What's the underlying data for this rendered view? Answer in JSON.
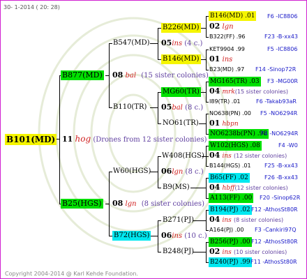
{
  "header": {
    "date": "30-  1-2014 ( 20: 28)"
  },
  "footer": {
    "copyright": "Copyright 2004-2014 @ Karl Kehde Foundation."
  },
  "root": {
    "id": "B101(MD)",
    "count": "11",
    "name": "hog",
    "sisters": "(Drones from 12 sister colonies)"
  },
  "gen1": [
    {
      "id": "B877(MD)",
      "count": "08",
      "name": "bal",
      "sisters": "(15 sister colonies)"
    },
    {
      "id": "B25(HGS)",
      "count": "08",
      "name": "lgn",
      "sisters": "(8 sister colonies)"
    }
  ],
  "gen2": [
    {
      "id": "B547(MD)",
      "count": "05",
      "name": "ins",
      "sisters": "(4 c.)"
    },
    {
      "id": "B110(TR)",
      "count": "05",
      "name": "bal",
      "sisters": "(8 c.)"
    },
    {
      "id": "W60(HGS)",
      "count": "06",
      "name": "lgn",
      "sisters": "(8 c.)"
    },
    {
      "id": "B72(HGS)",
      "count": "06",
      "name": "ins",
      "sisters": "(10 c.)"
    }
  ],
  "gen3": [
    {
      "id": "B226(MD)"
    },
    {
      "id": "B146(MD)"
    },
    {
      "id": "MG60(TR)"
    },
    {
      "id": "NO61(TR)"
    },
    {
      "id": "W408(HGS)"
    },
    {
      "id": "B9(MS)"
    },
    {
      "id": "B271(PJ)"
    },
    {
      "id": "B248(PJ)"
    }
  ],
  "gen4": [
    {
      "top_id": "B146(MD) .01",
      "top_ref": "F6 -IC8806",
      "count": "02",
      "name": "lgn",
      "sisters": "",
      "bot_id": "B322(FF) .96",
      "bot_ref": "F23 -B-xx43"
    },
    {
      "top_id": "KET9904 .99",
      "top_ref": "F5 -IC8806",
      "count": "01",
      "name": "ins",
      "sisters": "",
      "bot_id": "B23(MD) .97",
      "bot_ref": "F14 -Sinop72R"
    },
    {
      "top_id": "MG165(TR) .03",
      "top_ref": "F3 -MG00R",
      "count": "04",
      "name": "mrk",
      "sisters": "(15 sister colonies)",
      "bot_id": "I89(TR) .01",
      "bot_ref": "F6 -Takab93aR"
    },
    {
      "top_id": "NO638(PN) .00",
      "top_ref": "F5 -NO6294R",
      "count": "01",
      "name": "hbpn",
      "sisters": "",
      "bot_id": "NO6238b(PN) .98",
      "bot_ref": "F4 -NO6294R"
    },
    {
      "top_id": "W102(HGS) .08",
      "top_ref": "F4 -W0",
      "count": "04",
      "name": "ins",
      "sisters": "(12 sister colonies)",
      "bot_id": "B144(HGS) .01",
      "bot_ref": "F25 -B-xx43"
    },
    {
      "top_id": "B65(FF) .02",
      "top_ref": "F26 -B-xx43",
      "count": "04",
      "name": "hbff",
      "sisters": "(12 sister colonies)",
      "bot_id": "A113(FF) .00",
      "bot_ref": "F20 -Sinop62R"
    },
    {
      "top_id": "B194(PJ) .02",
      "top_ref": "F12 -AthosSt80R",
      "count": "04",
      "name": "ins",
      "sisters": "(8 sister colonies)",
      "bot_id": "A164(PJ) .00",
      "bot_ref": "F3 -Cankiri97Q"
    },
    {
      "top_id": "B256(PJ) .00",
      "top_ref": "F12 -AthosSt80R",
      "count": "02",
      "name": "ins",
      "sisters": "(10 sister colonies)",
      "bot_id": "B240(PJ) .99",
      "bot_ref": "F11 -AthosSt80R"
    }
  ],
  "colors": {
    "yellow": "#f5f500",
    "green": "#00e000",
    "cyan": "#00e8f0",
    "frame": "#d020d0",
    "name_red": "#d02020",
    "ref_blue": "#1818c8",
    "sister_purple": "#6040a0"
  }
}
